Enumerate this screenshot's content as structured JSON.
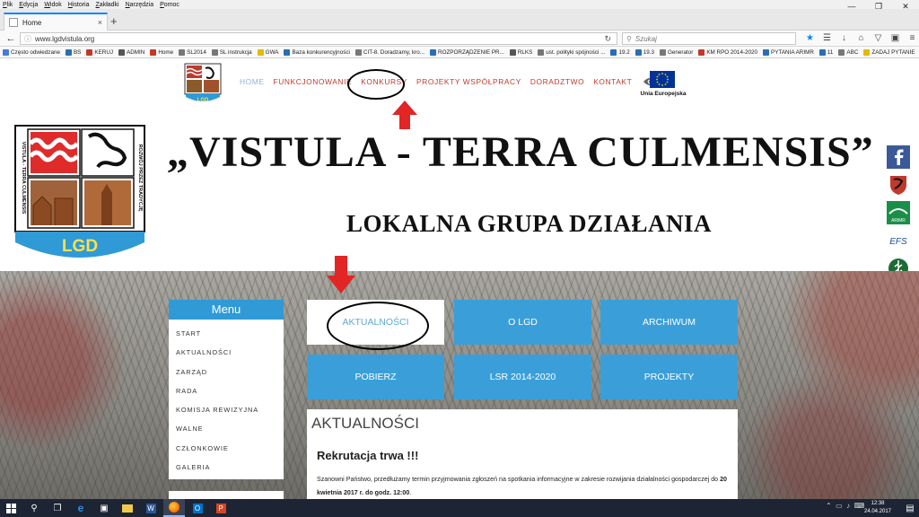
{
  "menubar": {
    "items": [
      "Plik",
      "Edycja",
      "Widok",
      "Historia",
      "Zakładki",
      "Narzędzia",
      "Pomoc"
    ]
  },
  "tab": {
    "title": "Home",
    "close": "×",
    "new_tab": "+"
  },
  "navbar": {
    "url": "www.lgdvistula.org",
    "search_placeholder": "Szukaj",
    "icons": [
      "back-icon",
      "reload-icon",
      "bookmark-star-icon",
      "library-icon",
      "download-icon",
      "home-icon",
      "pocket-icon",
      "extension-icon",
      "menu-icon"
    ]
  },
  "bookmarks": [
    {
      "label": "Często odwiedzane",
      "color": "#4a7bd4"
    },
    {
      "label": "BS",
      "color": "#2a6db5"
    },
    {
      "label": "KERUJ",
      "color": "#c0392b"
    },
    {
      "label": "ADMIN",
      "color": "#555555"
    },
    {
      "label": "Home",
      "color": "#c0392b"
    },
    {
      "label": "SL2014",
      "color": "#777777"
    },
    {
      "label": "SL instrukcja",
      "color": "#777777"
    },
    {
      "label": "GWA",
      "color": "#e6b800"
    },
    {
      "label": "Baza konkurencyjności",
      "color": "#2a6db5"
    },
    {
      "label": "CIT-8. Doradzamy, kro...",
      "color": "#777777"
    },
    {
      "label": "ROZPORZĄDZENIE PR...",
      "color": "#2a6db5"
    },
    {
      "label": "RLKS",
      "color": "#555555"
    },
    {
      "label": "ust. polityki spójności ...",
      "color": "#777777"
    },
    {
      "label": "19.2",
      "color": "#2a6db5"
    },
    {
      "label": "19.3",
      "color": "#2a6db5"
    },
    {
      "label": "Generator",
      "color": "#777777"
    },
    {
      "label": "KM RPO 2014-2020",
      "color": "#c0392b"
    },
    {
      "label": "PYTANIA ARIMR",
      "color": "#2a6db5"
    },
    {
      "label": "11",
      "color": "#2a6db5"
    },
    {
      "label": "ABC",
      "color": "#777777"
    },
    {
      "label": "ZADAJ PYTANIE",
      "color": "#e6b800"
    }
  ],
  "site": {
    "topnav": [
      "HOME",
      "FUNKCJONOWANIE",
      "KONKURSY",
      "PROJEKTY WSPÓŁPRACY",
      "DORADZTWO",
      "KONTAKT"
    ],
    "eu_label": "Unia Europejska",
    "small_logo_text": "LGD",
    "big_logo": {
      "badge": "LGD",
      "side_left": "VISTULA - TERRA CULMENSIS",
      "side_right": "ROZWÓJ PRZEZ TRADYCJĘ"
    },
    "title": "„VISTULA -  TERRA CULMENSIS”",
    "subtitle": "LOKALNA GRUPA DZIAŁANIA",
    "social": [
      "facebook-icon",
      "kujawsko-pomorskie-crest-icon",
      "arimr-icon",
      "efs-icon",
      "leader-icon"
    ],
    "social_labels": {
      "arimr": "ARiMR",
      "efs": "EFS"
    },
    "menu": {
      "header": "Menu",
      "items": [
        "START",
        "AKTUALNOŚCI",
        "ZARZĄD",
        "RADA",
        "KOMISJA REWIZYJNA",
        "WALNE",
        "CZŁONKOWIE",
        "GALERIA"
      ]
    },
    "tiles": [
      "AKTUALNOŚCI",
      "O LGD",
      "ARCHIWUM",
      "POBIERZ",
      "LSR 2014-2020",
      "PROJEKTY"
    ],
    "news": {
      "section": "AKTUALNOŚCI",
      "title": "Rekrutacja trwa !!!",
      "text_pre": "Szanowni Państwo, przedłużamy termin przyjmowania zgłoszeń na spotkania informacyjne w zakresie rozwijania działalności gospodarczej do ",
      "text_bold": "20 kwietnia 2017 r. do godz. 12:00",
      "text_post": "."
    },
    "accent_color": "#3a9fd9",
    "nav_color": "#c0392b"
  },
  "taskbar": {
    "time": "12:38",
    "date": "24.04.2017",
    "icons": [
      "start-icon",
      "search-icon",
      "task-view-icon",
      "edge-icon",
      "store-icon",
      "file-explorer-icon",
      "word-icon",
      "firefox-icon",
      "outlook-icon",
      "powerpoint-icon"
    ]
  }
}
